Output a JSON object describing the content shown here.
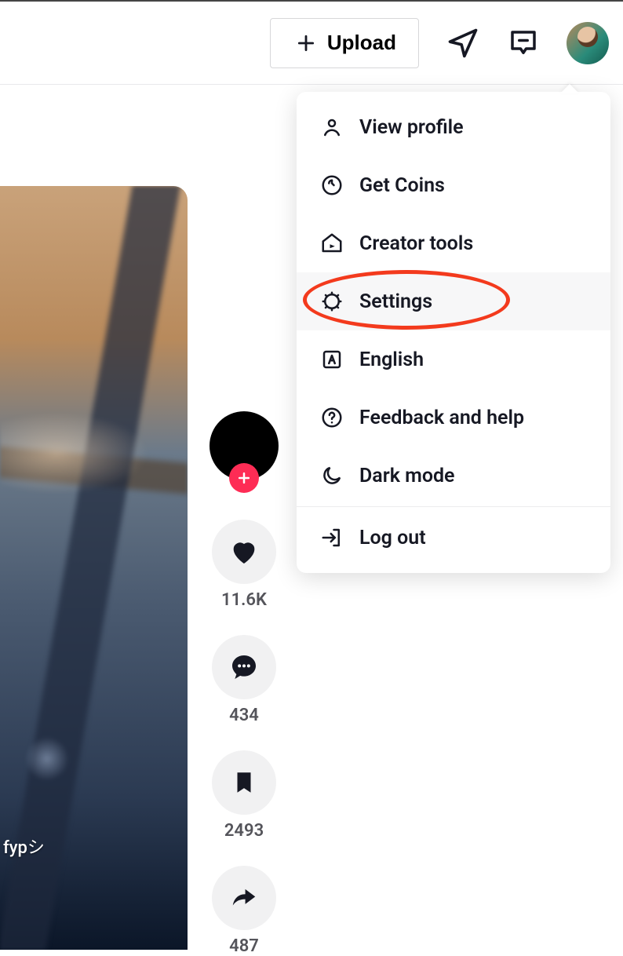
{
  "header": {
    "upload_label": "Upload"
  },
  "menu": {
    "view_profile": "View profile",
    "get_coins": "Get Coins",
    "creator_tools": "Creator tools",
    "settings": "Settings",
    "language": "English",
    "feedback": "Feedback and help",
    "dark_mode": "Dark mode",
    "log_out": "Log out"
  },
  "rail": {
    "likes": "11.6K",
    "comments": "434",
    "saves": "2493",
    "shares": "487"
  },
  "video": {
    "hashtag": "fypシ"
  }
}
